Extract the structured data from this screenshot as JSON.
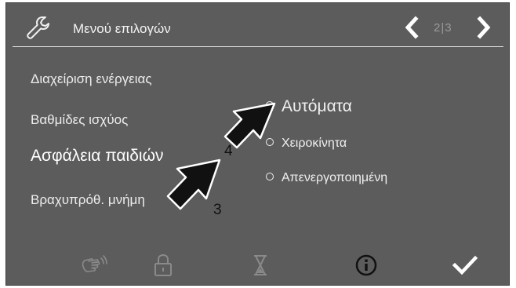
{
  "header": {
    "title": "Μενού επιλογών",
    "page_indicator": "2|3"
  },
  "menu": {
    "items": [
      {
        "label": "Διαχείριση ενέργειας"
      },
      {
        "label": "Βαθμίδες ισχύος"
      },
      {
        "label": "Ασφάλεια παιδιών"
      },
      {
        "label": "Βραχυπρόθ. μνήμη"
      }
    ]
  },
  "options": [
    {
      "label": "Αυτόματα",
      "selected": true
    },
    {
      "label": "Χειροκίνητα",
      "selected": false
    },
    {
      "label": "Απενεργοποιημένη",
      "selected": false
    }
  ],
  "callouts": {
    "arrow_a": "4",
    "arrow_b": "3"
  },
  "toolbar": {
    "icons": [
      "hand-wave-icon",
      "lock-icon",
      "hourglass-icon",
      "info-icon",
      "checkmark-icon"
    ]
  },
  "colors": {
    "panel_bg": "#5c5c5c",
    "text": "#f0f0f0",
    "inactive_icon": "#8a8a8a"
  }
}
